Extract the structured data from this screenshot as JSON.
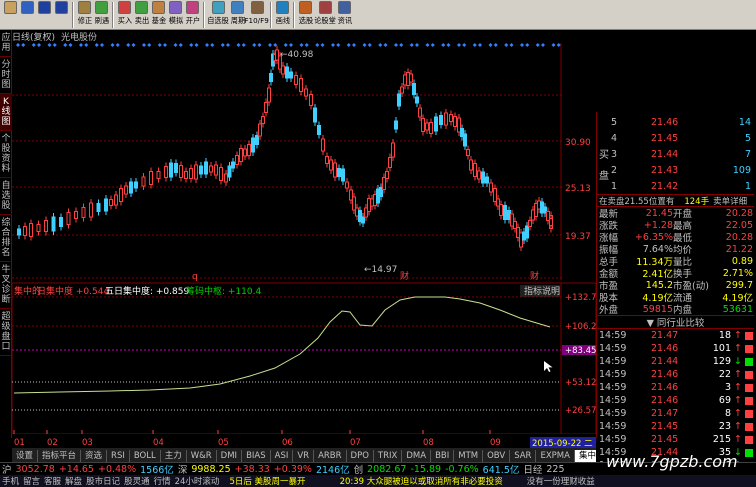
{
  "toolbar": {
    "items": [
      {
        "label": "",
        "icon": "box-icon"
      },
      {
        "label": "",
        "icon": "back-icon"
      },
      {
        "label": "",
        "icon": "up-arrow-icon"
      },
      {
        "label": "",
        "icon": "down-arrow-icon"
      },
      {
        "label": "修正",
        "icon": "edit-icon"
      },
      {
        "label": "刷遇",
        "icon": "refresh-icon"
      },
      {
        "label": "买入",
        "icon": "buy-icon"
      },
      {
        "label": "卖出",
        "icon": "sell-icon"
      },
      {
        "label": "基金",
        "icon": "fund-icon"
      },
      {
        "label": "模拟",
        "icon": "simulate-icon"
      },
      {
        "label": "开户",
        "icon": "account-icon"
      },
      {
        "label": "自选股",
        "icon": "favorites-icon"
      },
      {
        "label": "周期",
        "icon": "cycle-icon"
      },
      {
        "label": "F10/F9",
        "icon": "f10-icon"
      },
      {
        "label": "画线",
        "icon": "draw-icon"
      },
      {
        "label": "",
        "icon": "sep-icon"
      },
      {
        "label": "选股",
        "icon": "select-icon"
      },
      {
        "label": "论股堂",
        "icon": "forum-icon"
      },
      {
        "label": "资讯",
        "icon": "news-icon"
      }
    ]
  },
  "title": {
    "period": "日线(复权)",
    "stock": "光电股份"
  },
  "left_tabs": [
    "应用",
    "分时图",
    "K线图",
    "个股资料",
    "自选股",
    "综合排名",
    "牛叉诊断",
    "超级盘口"
  ],
  "chart": {
    "price_ticks": [
      "30.90",
      "25.13",
      "19.37"
    ],
    "high_label": "40.98",
    "low_label": "14.97",
    "events": [
      "q",
      "财",
      "财"
    ]
  },
  "indicator": {
    "name": "集中的",
    "line1_label": "日集中度",
    "line1_value": "+0.544",
    "line2_label": "五日集中度",
    "line2_value": "+0.859",
    "line3_label": "筹码中枢",
    "line3_value": "+110.4",
    "help": "指标说明",
    "y_ticks": [
      "132.7",
      "106.2",
      "83.45",
      "53.12",
      "26.57"
    ]
  },
  "x_axis": {
    "labels": [
      "01",
      "02",
      "03",
      "04",
      "05",
      "06",
      "07",
      "08",
      "09"
    ],
    "date_box": "2015-09-22 二"
  },
  "tabs": [
    "设置",
    "指标平台",
    "资选",
    "RSI",
    "BOLL",
    "主力",
    "W&R",
    "DMI",
    "BIAS",
    "ASI",
    "VR",
    "ARBR",
    "DPO",
    "TRIX",
    "DMA",
    "BBI",
    "MTM",
    "OBV",
    "SAR",
    "EXPMA",
    "集中的"
  ],
  "order_book": {
    "sell": [
      {
        "lvl": "5",
        "price": "21.46",
        "vol": "14"
      },
      {
        "lvl": "4",
        "price": "21.45",
        "vol": "5"
      },
      {
        "lvl": "3",
        "price": "21.44",
        "vol": "7"
      },
      {
        "lvl": "2",
        "price": "21.43",
        "vol": "109"
      },
      {
        "lvl": "1",
        "price": "21.42",
        "vol": "1"
      }
    ],
    "sell_side_label": "卖盘",
    "header": {
      "left": "在卖盘21.55",
      "mid": "位置有",
      "right": "124手",
      "tail": "卖单详细"
    },
    "side_a": "买",
    "side_b": "盘"
  },
  "quote": [
    {
      "k": "最新",
      "v": "21.45",
      "k2": "开盘",
      "v2": "20.28",
      "c": "#ff4040",
      "c2": "#ff4040"
    },
    {
      "k": "涨跌",
      "v": "+1.28",
      "k2": "最高",
      "v2": "22.05",
      "c": "#ff4040",
      "c2": "#ff4040"
    },
    {
      "k": "涨幅",
      "v": "+6.35%",
      "k2": "最低",
      "v2": "20.28",
      "c": "#ff4040",
      "c2": "#ff4040"
    },
    {
      "k": "振幅",
      "v": "7.64%",
      "k2": "均价",
      "v2": "21.22",
      "c": "#c0c0c0",
      "c2": "#ff4040"
    },
    {
      "k": "总手",
      "v": "11.34万",
      "k2": "量比",
      "v2": "0.89",
      "c": "#ffff00",
      "c2": "#ffff00"
    },
    {
      "k": "金额",
      "v": "2.41亿",
      "k2": "换手",
      "v2": "2.71%",
      "c": "#ffff00",
      "c2": "#ffff00"
    },
    {
      "k": "市盈",
      "v": "145.2",
      "k2": "市盈(动)",
      "v2": "299.7",
      "c": "#ffff00",
      "c2": "#ffff00"
    },
    {
      "k": "股本",
      "v": "4.19亿",
      "k2": "流通",
      "v2": "4.19亿",
      "c": "#ffff00",
      "c2": "#ffff00"
    },
    {
      "k": "外盘",
      "v": "59815",
      "k2": "内盘",
      "v2": "53631",
      "c": "#ff4040",
      "c2": "#00e000"
    }
  ],
  "industry_label": "同行业比较",
  "trades": [
    {
      "t": "14:59",
      "p": "21.47",
      "v": "18",
      "dir": "up"
    },
    {
      "t": "14:59",
      "p": "21.46",
      "v": "101",
      "dir": "up"
    },
    {
      "t": "14:59",
      "p": "21.44",
      "v": "129",
      "dir": "down"
    },
    {
      "t": "14:59",
      "p": "21.46",
      "v": "22",
      "dir": "up"
    },
    {
      "t": "14:59",
      "p": "21.46",
      "v": "3",
      "dir": "up"
    },
    {
      "t": "14:59",
      "p": "21.46",
      "v": "69",
      "dir": "up"
    },
    {
      "t": "14:59",
      "p": "21.47",
      "v": "8",
      "dir": "up"
    },
    {
      "t": "14:59",
      "p": "21.45",
      "v": "23",
      "dir": "up"
    },
    {
      "t": "14:59",
      "p": "21.45",
      "v": "215",
      "dir": "up"
    },
    {
      "t": "14:59",
      "p": "21.44",
      "v": "35",
      "dir": "down"
    },
    {
      "t": "14:59",
      "p": "21.46",
      "v": "6",
      "dir": "up"
    },
    {
      "t": "15:00",
      "p": "21.45",
      "v": "16",
      "dir": "up"
    }
  ],
  "status": {
    "sh_label": "沪",
    "sh_value": "3052.78",
    "sh_chg": "+14.65",
    "sh_pct": "+0.48%",
    "sh_amt": "1566亿",
    "sz_label": "深",
    "sz_value": "9988.25",
    "sz_chg": "+38.33",
    "sz_pct": "+0.39%",
    "sz_amt": "2146亿",
    "cy_label": "创",
    "cy_value": "2082.67",
    "cy_chg": "-15.89",
    "cy_pct": "-0.76%",
    "cy_amt": "641.5亿",
    "rj_label": "日经",
    "rj_value": "225",
    "links": [
      "手机",
      "留言",
      "客服",
      "解盘",
      "股市日记",
      "股灵通",
      "行情",
      "24小时滚动"
    ],
    "news1": "5日后 美股周一暴开",
    "news2": "20:39 大众腿被迫以或取消所有非必要投资",
    "news3": "没有一份理财收益"
  },
  "watermark": "www.7gpzb.com"
}
